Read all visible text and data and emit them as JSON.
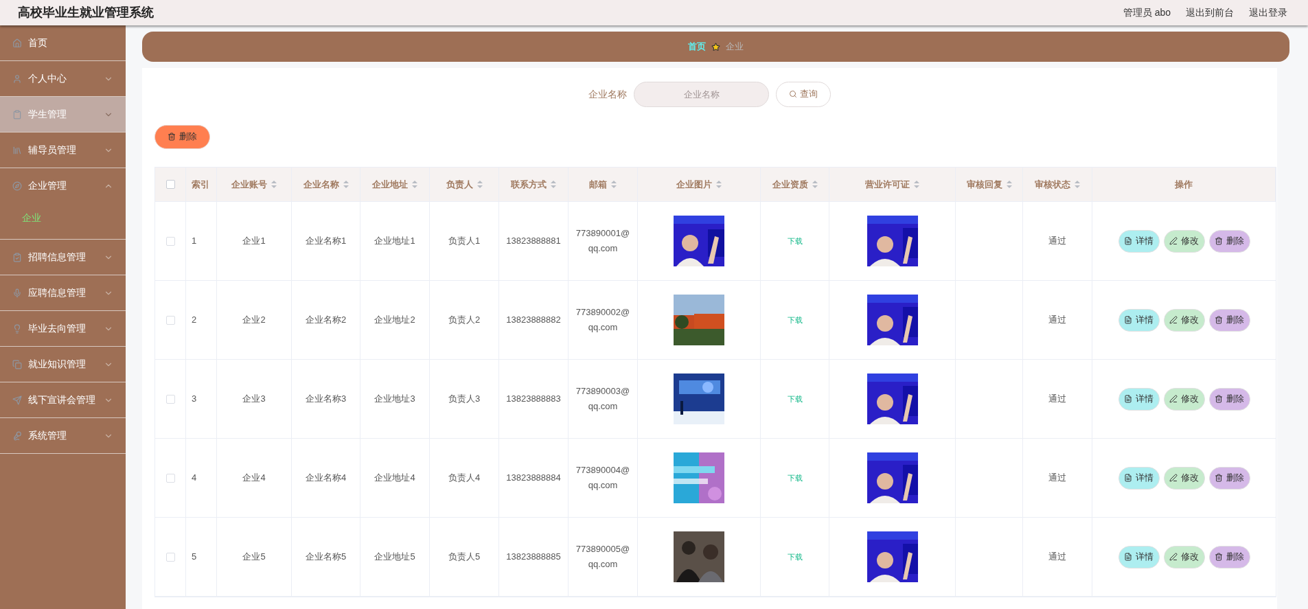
{
  "header": {
    "title": "高校毕业生就业管理系统",
    "links": [
      "管理员 abo",
      "退出到前台",
      "退出登录"
    ]
  },
  "sidebar": {
    "items": [
      {
        "label": "首页",
        "kind": "link",
        "selected": false
      },
      {
        "label": "个人中心",
        "kind": "menu",
        "selected": false,
        "expanded": false
      },
      {
        "label": "学生管理",
        "kind": "menu",
        "selected": true,
        "expanded": false
      },
      {
        "label": "辅导员管理",
        "kind": "menu",
        "selected": false,
        "expanded": false
      },
      {
        "label": "企业管理",
        "kind": "menu",
        "selected": false,
        "expanded": true,
        "children": [
          {
            "label": "企业",
            "selected": true
          }
        ]
      },
      {
        "label": "招聘信息管理",
        "kind": "menu",
        "selected": false,
        "expanded": false
      },
      {
        "label": "应聘信息管理",
        "kind": "menu",
        "selected": false,
        "expanded": false
      },
      {
        "label": "毕业去向管理",
        "kind": "menu",
        "selected": false,
        "expanded": false
      },
      {
        "label": "就业知识管理",
        "kind": "menu",
        "selected": false,
        "expanded": false
      },
      {
        "label": "线下宣讲会管理",
        "kind": "menu",
        "selected": false,
        "expanded": false
      },
      {
        "label": "系统管理",
        "kind": "menu",
        "selected": false,
        "expanded": false
      }
    ]
  },
  "breadcrumb": {
    "home": "首页",
    "current": "企业"
  },
  "search": {
    "label": "企业名称",
    "placeholder": "企业名称",
    "button": "查询"
  },
  "delete_button": "删除",
  "table": {
    "select_all": {
      "checked": false
    },
    "columns": [
      {
        "label": "索引",
        "sortable": false
      },
      {
        "label": "企业账号",
        "sortable": true
      },
      {
        "label": "企业名称",
        "sortable": true
      },
      {
        "label": "企业地址",
        "sortable": true
      },
      {
        "label": "负责人",
        "sortable": true
      },
      {
        "label": "联系方式",
        "sortable": true
      },
      {
        "label": "邮箱",
        "sortable": true
      },
      {
        "label": "企业图片",
        "sortable": true
      },
      {
        "label": "企业资质",
        "sortable": true
      },
      {
        "label": "营业许可证",
        "sortable": true
      },
      {
        "label": "审核回复",
        "sortable": true
      },
      {
        "label": "审核状态",
        "sortable": true
      },
      {
        "label": "操作",
        "sortable": false
      }
    ],
    "rows": [
      {
        "checked": false,
        "index": "1",
        "account": "企业1",
        "name": "企业名称1",
        "address": "企业地址1",
        "contact": "负责人1",
        "phone": "13823888881",
        "email": "773890001@qq.com",
        "image": {
          "kind": "picture"
        },
        "qualification": "下载",
        "license": {
          "kind": "picture"
        },
        "status": "通过",
        "actions": [
          "详情",
          "修改",
          "删除"
        ]
      },
      {
        "checked": false,
        "index": "2",
        "account": "企业2",
        "name": "企业名称2",
        "address": "企业地址2",
        "contact": "负责人2",
        "phone": "13823888882",
        "email": "773890002@qq.com",
        "image": {
          "kind": "picture"
        },
        "qualification": "下载",
        "license": {
          "kind": "picture"
        },
        "status": "通过",
        "actions": [
          "详情",
          "修改",
          "删除"
        ]
      },
      {
        "checked": false,
        "index": "3",
        "account": "企业3",
        "name": "企业名称3",
        "address": "企业地址3",
        "contact": "负责人3",
        "phone": "13823888883",
        "email": "773890003@qq.com",
        "image": {
          "kind": "picture"
        },
        "qualification": "下载",
        "license": {
          "kind": "picture"
        },
        "status": "通过",
        "actions": [
          "详情",
          "修改",
          "删除"
        ]
      },
      {
        "checked": false,
        "index": "4",
        "account": "企业4",
        "name": "企业名称4",
        "address": "企业地址4",
        "contact": "负责人4",
        "phone": "13823888884",
        "email": "773890004@qq.com",
        "image": {
          "kind": "picture"
        },
        "qualification": "下载",
        "license": {
          "kind": "picture"
        },
        "status": "通过",
        "actions": [
          "详情",
          "修改",
          "删除"
        ]
      },
      {
        "checked": false,
        "index": "5",
        "account": "企业5",
        "name": "企业名称5",
        "address": "企业地址5",
        "contact": "负责人5",
        "phone": "13823888885",
        "email": "773890005@qq.com",
        "image": {
          "kind": "picture"
        },
        "qualification": "下载",
        "license": {
          "kind": "picture"
        },
        "status": "通过",
        "actions": [
          "详情",
          "修改",
          "删除"
        ]
      }
    ]
  }
}
